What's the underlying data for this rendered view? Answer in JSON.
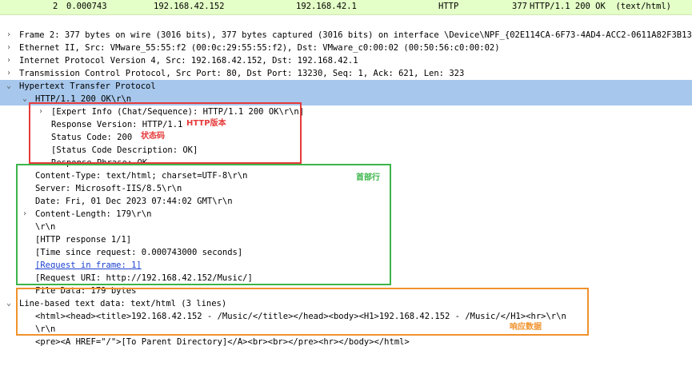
{
  "packet_list": {
    "row": {
      "no": "2",
      "time": "0.000743",
      "source": "192.168.42.152",
      "destination": "192.168.42.1",
      "protocol": "HTTP",
      "length": "377",
      "info": "HTTP/1.1 200 OK  (text/html)"
    }
  },
  "colors": {
    "packet_row_bg": "#e4ffc7",
    "selected_bg": "#a7c7ec",
    "red_box": "#e53a3a",
    "green_box": "#3cb54a",
    "orange_box": "#f0922c"
  },
  "tree": {
    "frame": "Frame 2: 377 bytes on wire (3016 bits), 377 bytes captured (3016 bits) on interface \\Device\\NPF_{02E114CA-6F73-4AD4-ACC2-0611A82F3B13},",
    "ethernet": "Ethernet II, Src: VMware_55:55:f2 (00:0c:29:55:55:f2), Dst: VMware_c0:00:02 (00:50:56:c0:00:02)",
    "ip": "Internet Protocol Version 4, Src: 192.168.42.152, Dst: 192.168.42.1",
    "tcp": "Transmission Control Protocol, Src Port: 80, Dst Port: 13230, Seq: 1, Ack: 621, Len: 323",
    "http": "Hypertext Transfer Protocol",
    "status_line": "HTTP/1.1 200 OK\\r\\n",
    "expert_info": "[Expert Info (Chat/Sequence): HTTP/1.1 200 OK\\r\\n]",
    "response_version": "Response Version: HTTP/1.1",
    "status_code": "Status Code: 200",
    "status_desc": "[Status Code Description: OK]",
    "response_phrase": "Response Phrase: OK",
    "content_type": "Content-Type: text/html; charset=UTF-8\\r\\n",
    "server": "Server: Microsoft-IIS/8.5\\r\\n",
    "date": "Date: Fri, 01 Dec 2023 07:44:02 GMT\\r\\n",
    "content_length": "Content-Length: 179\\r\\n",
    "crlf": "\\r\\n",
    "http_response": "[HTTP response 1/1]",
    "time_since": "[Time since request: 0.000743000 seconds]",
    "request_in_frame": "[Request in frame: 1]",
    "request_uri": "[Request URI: http://192.168.42.152/Music/]",
    "file_data": "File Data: 179 bytes",
    "line_based": "Line-based text data: text/html (3 lines)",
    "html_line1": "<html><head><title>192.168.42.152 - /Music/</title></head><body><H1>192.168.42.152 - /Music/</H1><hr>\\r\\n",
    "html_line2": "\\r\\n",
    "html_line3": "<pre><A HREF=\"/\">[To Parent Directory]</A><br><br></pre><hr></body></html>"
  },
  "annotations": {
    "http_version": "HTTP版本",
    "status_code": "状态码",
    "header_lines": "首部行",
    "response_data": "响应数据"
  }
}
